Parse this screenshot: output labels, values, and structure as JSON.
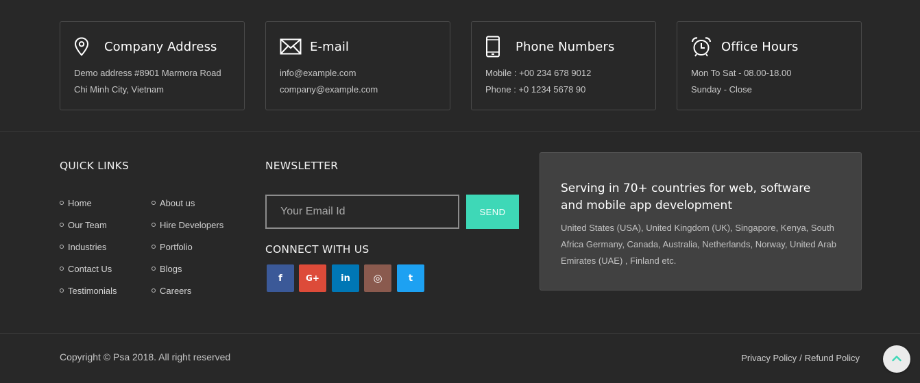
{
  "contact_cards": [
    {
      "title": "Company Address",
      "icon": "map-pin-icon",
      "lines": [
        "Demo address #8901 Marmora Road",
        "Chi Minh City, Vietnam"
      ]
    },
    {
      "title": "E-mail",
      "icon": "envelope-icon",
      "lines": [
        "info@example.com",
        "company@example.com"
      ]
    },
    {
      "title": "Phone Numbers",
      "icon": "mobile-phone-icon",
      "lines": [
        "Mobile : +00 234 678 9012",
        "Phone : +0 1234 5678 90"
      ]
    },
    {
      "title": "Office Hours",
      "icon": "alarm-clock-icon",
      "lines": [
        "Mon To Sat - 08.00-18.00",
        "Sunday - Close"
      ]
    }
  ],
  "quick_links": {
    "title": "QUICK LINKS",
    "col1": [
      "Home",
      "Our Team",
      "Industries",
      "Contact Us",
      "Testimonials"
    ],
    "col2": [
      "About us",
      "Hire Developers",
      "Portfolio",
      "Blogs",
      "Careers"
    ]
  },
  "newsletter": {
    "title": "NEWSLETTER",
    "placeholder": "Your Email Id",
    "value": "",
    "send_label": "SEND"
  },
  "connect": {
    "title": "CONNECT WITH US",
    "socials": [
      {
        "icon": "facebook-icon",
        "glyph": "f",
        "color": "#3b5998"
      },
      {
        "icon": "google-plus-icon",
        "glyph": "G+",
        "color": "#dd4b39"
      },
      {
        "icon": "linkedin-icon",
        "glyph": "in",
        "color": "#0077b5"
      },
      {
        "icon": "instagram-icon",
        "glyph": "◎",
        "color": "#8a5a4e"
      },
      {
        "icon": "twitter-icon",
        "glyph": "t",
        "color": "#1da1f2"
      }
    ]
  },
  "countries": {
    "heading": "Serving in 70+ countries for web, software and mobile app development",
    "text": "United States (USA), United Kingdom (UK), Singapore, Kenya, South Africa Germany, Canada, Australia, Netherlands, Norway, United Arab Emirates (UAE) , Finland etc."
  },
  "footer": {
    "copyright": "Copyright © Psa 2018. All right reserved",
    "privacy": "Privacy Policy",
    "separator": "/",
    "refund": "Refund Policy"
  },
  "colors": {
    "background": "#282828",
    "accent": "#3ed8b7",
    "card_border": "#4a4a4a",
    "panel": "#414141"
  }
}
